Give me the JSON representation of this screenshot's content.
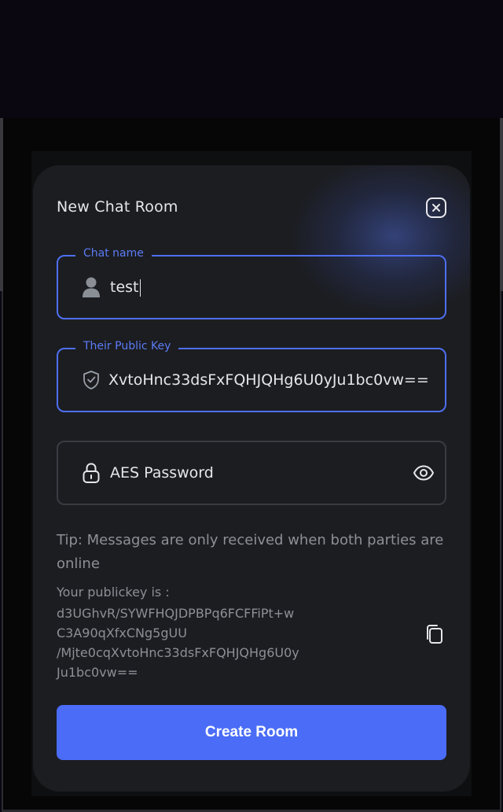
{
  "modal": {
    "title": "New Chat Room"
  },
  "fields": {
    "chat_name": {
      "label": "Chat name",
      "value": "test"
    },
    "public_key": {
      "label": "Their Public Key",
      "value": "XvtoHnc33dsFxFQHJQHg6U0yJu1bc0vw=="
    },
    "aes_password": {
      "placeholder": "AES Password"
    }
  },
  "tip": "Tip: Messages are only received when both parties are online",
  "your_key": {
    "label": "Your publickey is :",
    "lines": [
      "d3UGhvR/SYWFHQJDPBPq6FCFFiPt+w",
      "C3A90qXfxCNg5gUU",
      "/Mjte0cqXvtoHnc33dsFxFQHJQHg6U0y",
      "Ju1bc0vw=="
    ]
  },
  "create_button": "Create Room",
  "icons": {
    "close": "close-icon",
    "user": "user-icon",
    "shield": "shield-check-icon",
    "lock": "lock-icon",
    "eye": "eye-icon",
    "copy": "copy-icon"
  },
  "colors": {
    "accent": "#4a6cf7",
    "modal_bg": "#1c1d21",
    "page_bg": "#0a0711",
    "muted_text": "#8e8f96"
  }
}
